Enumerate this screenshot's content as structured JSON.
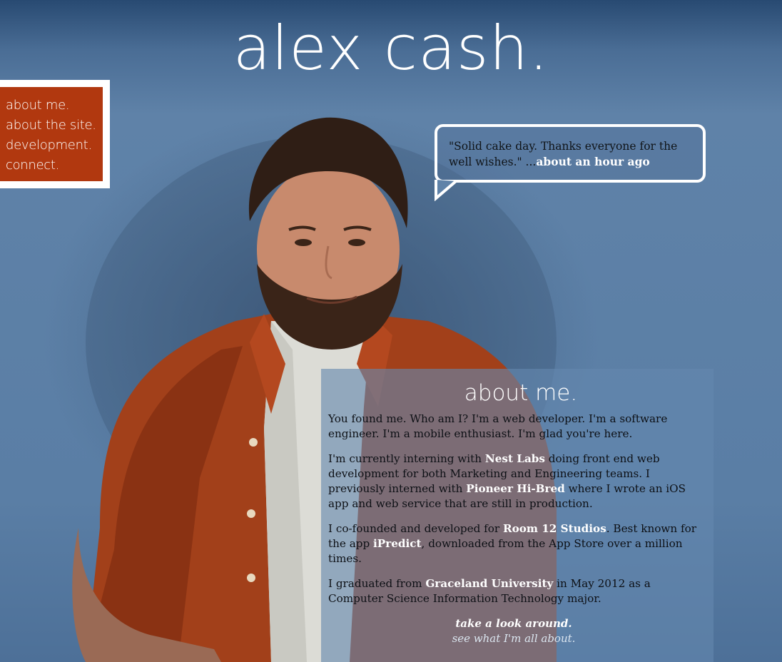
{
  "site": {
    "title": "alex cash."
  },
  "nav": {
    "items": [
      "about me.",
      "about the site.",
      "development.",
      "connect."
    ]
  },
  "tweet": {
    "text": "\"Solid cake day. Thanks everyone for the well wishes.\" ...",
    "time_link": "about an hour ago"
  },
  "about": {
    "heading": "about me.",
    "p1": "You found me. Who am I? I'm a web developer. I'm a software engineer. I'm a mobile enthusiast. I'm glad you're here.",
    "p2": {
      "a": "I'm currently interning with ",
      "link1": "Nest Labs",
      "b": " doing front end web development for both Marketing and Engineering teams. I previously interned with ",
      "link2": "Pioneer Hi-Bred",
      "c": " where I wrote an iOS app and web service that are still in production."
    },
    "p3": {
      "a": "I co-founded and developed for ",
      "link1": "Room 12 Studios",
      "b": ". Best known for the app ",
      "link2": "iPredict",
      "c": ", downloaded from the App Store over a million times."
    },
    "p4": {
      "a": "I graduated from ",
      "link1": "Graceland University",
      "b": " in May 2012 as a Computer Science Information Technology major."
    },
    "cta_line1": "take a look around.",
    "cta_line2": "see what I'm all about."
  },
  "colors": {
    "background": "#5a7ea5",
    "nav_bg": "#b1380f",
    "link": "#ffffff"
  }
}
